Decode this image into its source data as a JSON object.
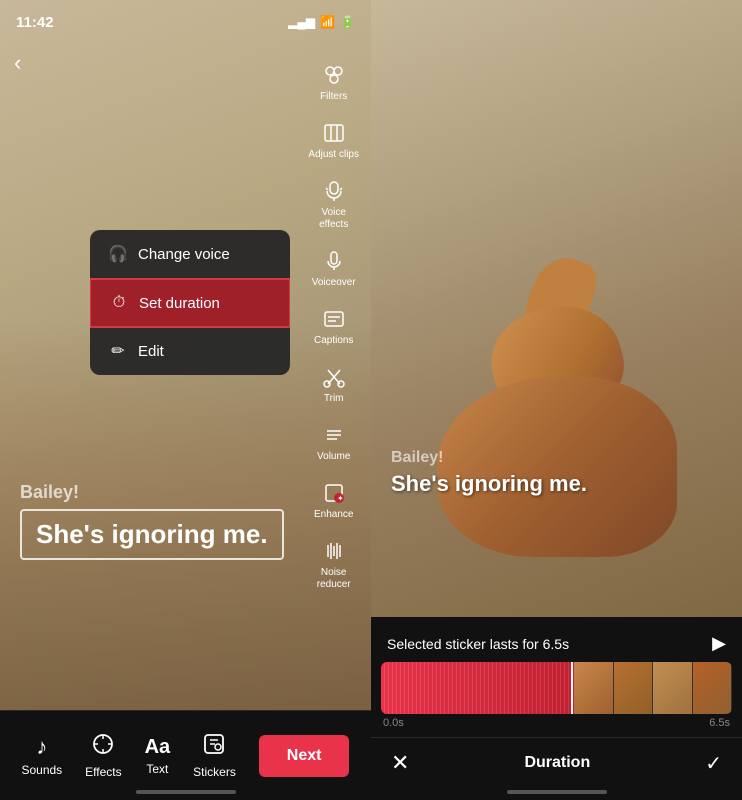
{
  "left": {
    "statusBar": {
      "time": "11:42",
      "moonIcon": "🌙"
    },
    "backButton": "‹",
    "contextMenu": {
      "items": [
        {
          "icon": "🎧",
          "label": "Change voice",
          "active": false
        },
        {
          "icon": "⏱",
          "label": "Set duration",
          "active": true
        },
        {
          "icon": "✏️",
          "label": "Edit",
          "active": false
        }
      ]
    },
    "toolbar": {
      "items": [
        {
          "icon": "✨",
          "label": "Filters"
        },
        {
          "icon": "⬛",
          "label": "Adjust clips"
        },
        {
          "icon": "🔊",
          "label": "Voice\neffects"
        },
        {
          "icon": "🎙",
          "label": "Voiceover"
        },
        {
          "icon": "📝",
          "label": "Captions"
        },
        {
          "icon": "✂️",
          "label": "Trim"
        },
        {
          "icon": "≡",
          "label": "Volume"
        },
        {
          "icon": "⚡",
          "label": "Enhance"
        },
        {
          "icon": "🔇",
          "label": "Noise\nreducer"
        }
      ]
    },
    "videoText": {
      "name": "Bailey!",
      "caption": "She's ignoring me."
    },
    "bottomBar": {
      "items": [
        {
          "icon": "♪",
          "label": "Sounds"
        },
        {
          "icon": "⏰",
          "label": "Effects"
        },
        {
          "icon": "Aa",
          "label": "Text"
        },
        {
          "icon": "🐾",
          "label": "Stickers"
        }
      ],
      "nextButton": "Next"
    }
  },
  "right": {
    "videoText": {
      "name": "Bailey!",
      "caption": "She's ignoring me."
    },
    "stickerInfo": {
      "text": "Selected sticker lasts for 6.5s",
      "playIcon": "▶"
    },
    "timeline": {
      "startLabel": "0.0s",
      "endLabel": "6.5s"
    },
    "actionBar": {
      "closeIcon": "✕",
      "title": "Duration",
      "checkIcon": "✓"
    }
  }
}
